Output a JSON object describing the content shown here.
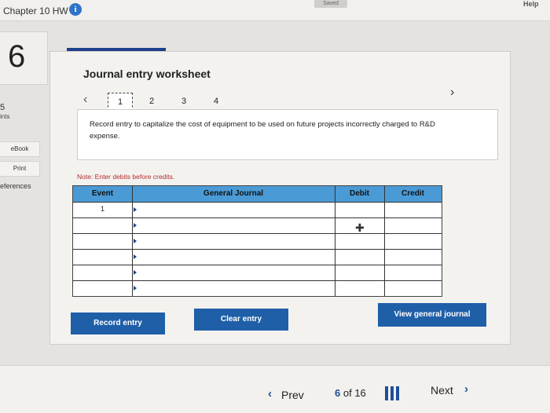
{
  "header": {
    "assignment_title": "Chapter 10 HW",
    "info_icon": "i",
    "saved_label": "Saved",
    "help_label": "Help"
  },
  "sidebar": {
    "question_number": "6",
    "points_value": "5",
    "points_label": "ints",
    "ebook_label": "eBook",
    "print_label": "Print",
    "references_label": "eferences"
  },
  "worksheet": {
    "title": "Journal entry worksheet",
    "tabs": [
      "1",
      "2",
      "3",
      "4"
    ],
    "active_tab": "1",
    "prev_icon": "chevron-left",
    "next_icon": "chevron-right",
    "prompt": "Record entry to capitalize the cost of equipment to be used on future projects incorrectly charged to R&D expense.",
    "note": "Note: Enter debits before credits."
  },
  "journal_table": {
    "columns": [
      "Event",
      "General Journal",
      "Debit",
      "Credit"
    ],
    "rows": [
      {
        "event": "1",
        "account": "",
        "debit": "",
        "credit": ""
      },
      {
        "event": "",
        "account": "",
        "debit": "",
        "credit": ""
      },
      {
        "event": "",
        "account": "",
        "debit": "",
        "credit": ""
      },
      {
        "event": "",
        "account": "",
        "debit": "",
        "credit": ""
      },
      {
        "event": "",
        "account": "",
        "debit": "",
        "credit": ""
      },
      {
        "event": "",
        "account": "",
        "debit": "",
        "credit": ""
      }
    ]
  },
  "buttons": {
    "record_entry": "Record entry",
    "clear_entry": "Clear entry",
    "view_general_journal": "View general journal"
  },
  "footer": {
    "prev_label": "Prev",
    "current_page": "6",
    "of_label": "of",
    "total_pages": "16",
    "next_label": "Next"
  },
  "colors": {
    "accent": "#1f5fa8",
    "table_header": "#4a9ad6",
    "note_red": "#b32d2d"
  }
}
